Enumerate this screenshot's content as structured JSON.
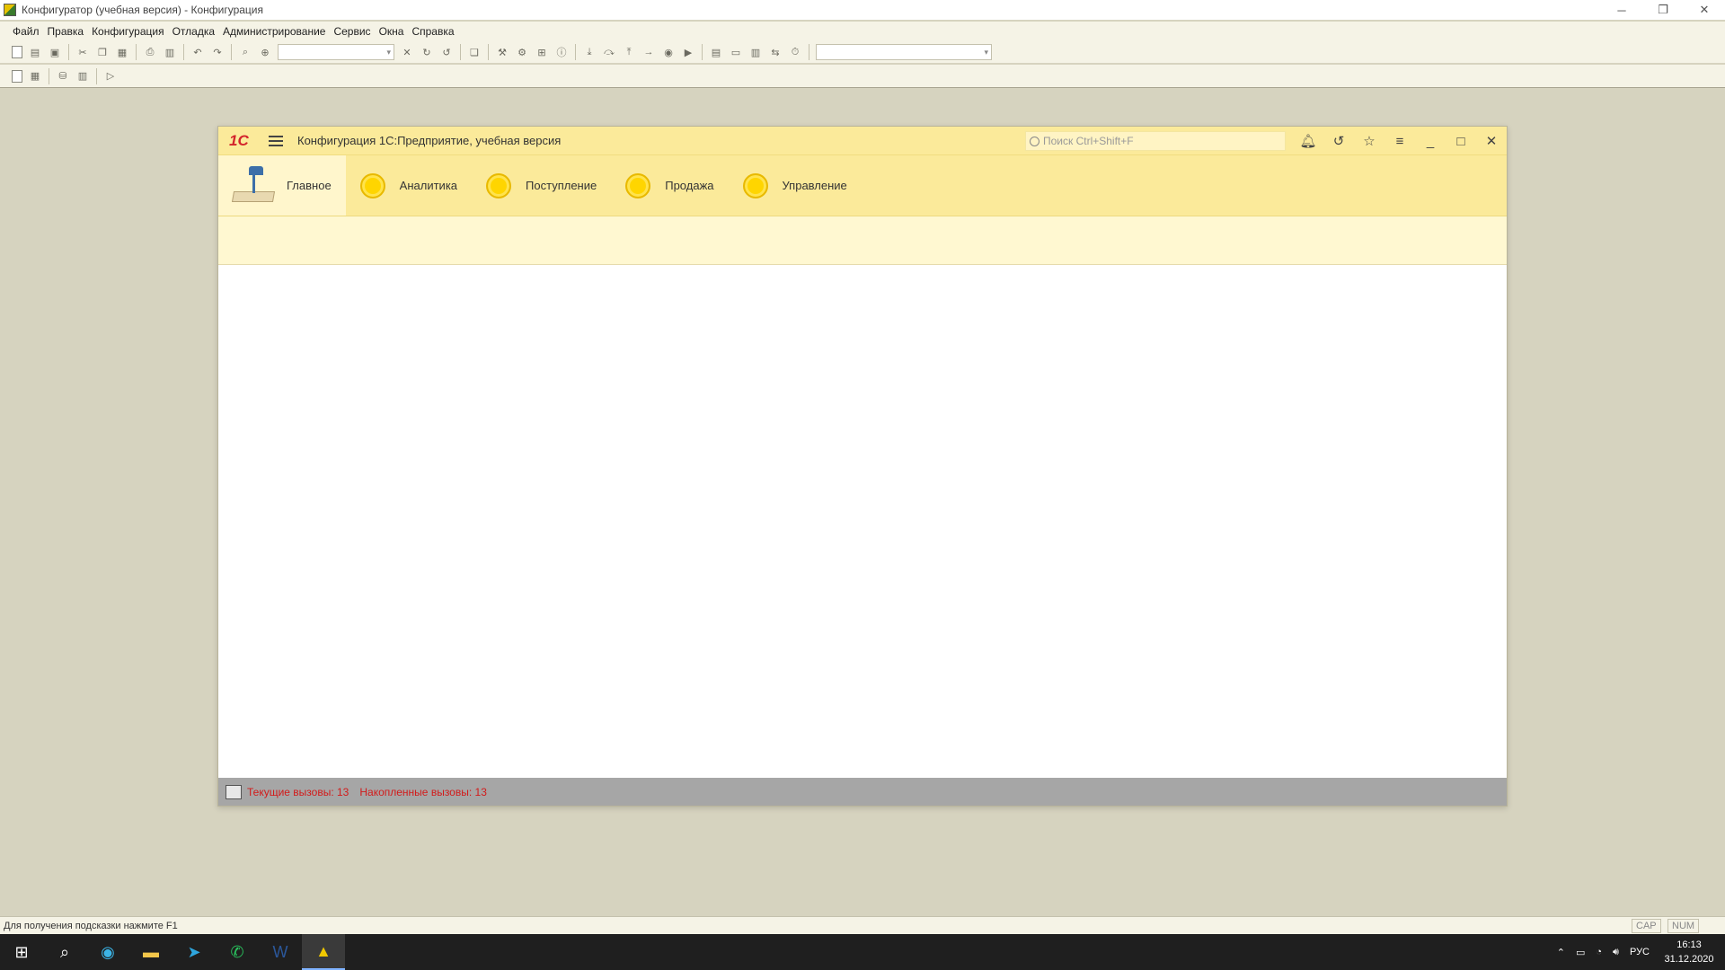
{
  "window": {
    "title": "Конфигуратор (учебная версия) - Конфигурация",
    "controls": [
      "─",
      "❐",
      "✕"
    ]
  },
  "menu": [
    "Файл",
    "Правка",
    "Конфигурация",
    "Отладка",
    "Администрирование",
    "Сервис",
    "Окна",
    "Справка"
  ],
  "inner": {
    "logo": "1С",
    "title": "Конфигурация 1С:Предприятие, учебная версия",
    "search_placeholder": "Поиск Ctrl+Shift+F",
    "icons": {
      "bell": "bell-icon",
      "history": "history-icon",
      "favorites": "star-icon",
      "menu": "filter-menu-icon",
      "minimize": "minimize-icon",
      "maximize": "maximize-icon",
      "close": "close-icon"
    },
    "sections": [
      {
        "label": "Главное"
      },
      {
        "label": "Аналитика"
      },
      {
        "label": "Поступление"
      },
      {
        "label": "Продажа"
      },
      {
        "label": "Управление"
      }
    ],
    "status": {
      "current_calls": "Текущие вызовы: 13",
      "accumulated_calls": "Накопленные вызовы: 13"
    },
    "colors": {
      "header": "#fbea9a",
      "status_text": "#d21b1b"
    }
  },
  "hint": "Для получения подсказки нажмите F1",
  "indicators": {
    "cap": "CAP",
    "num": "NUM"
  },
  "tray": {
    "lang": "РУС",
    "time": "16:13",
    "date": "31.12.2020"
  }
}
